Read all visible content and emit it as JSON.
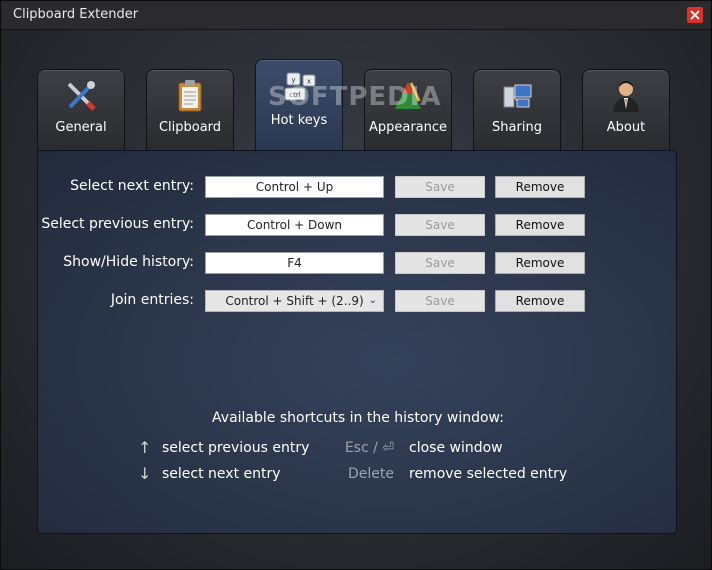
{
  "window": {
    "title": "Clipboard Extender"
  },
  "tabs": [
    {
      "label": "General",
      "icon": "tools-icon"
    },
    {
      "label": "Clipboard",
      "icon": "clipboard-icon"
    },
    {
      "label": "Hot keys",
      "icon": "keyboard-keys-icon",
      "key_labels": [
        "y",
        "x",
        "ctrl"
      ]
    },
    {
      "label": "Appearance",
      "icon": "palette-icon"
    },
    {
      "label": "Sharing",
      "icon": "network-computers-icon"
    },
    {
      "label": "About",
      "icon": "person-icon"
    }
  ],
  "hotkeys": [
    {
      "label": "Select next entry:",
      "value": "Control + Up",
      "save": "Save",
      "remove": "Remove"
    },
    {
      "label": "Select previous entry:",
      "value": "Control + Down",
      "save": "Save",
      "remove": "Remove"
    },
    {
      "label": "Show/Hide history:",
      "value": "F4",
      "save": "Save",
      "remove": "Remove"
    },
    {
      "label": "Join entries:",
      "value": "Control + Shift + (2..9)",
      "save": "Save",
      "remove": "Remove"
    }
  ],
  "shortcuts": {
    "title": "Available shortcuts in the history window:",
    "items": [
      {
        "key": "↑",
        "action": "select previous entry"
      },
      {
        "key": "↓",
        "action": "select next entry"
      },
      {
        "key": "Esc / ⏎",
        "action": "close window"
      },
      {
        "key": "Delete",
        "action": "remove selected entry"
      }
    ]
  },
  "watermark": "SOFTPEDIA",
  "colors": {
    "active_tab": "#34425e",
    "close": "#d9312b",
    "panel": "#2c364a"
  }
}
